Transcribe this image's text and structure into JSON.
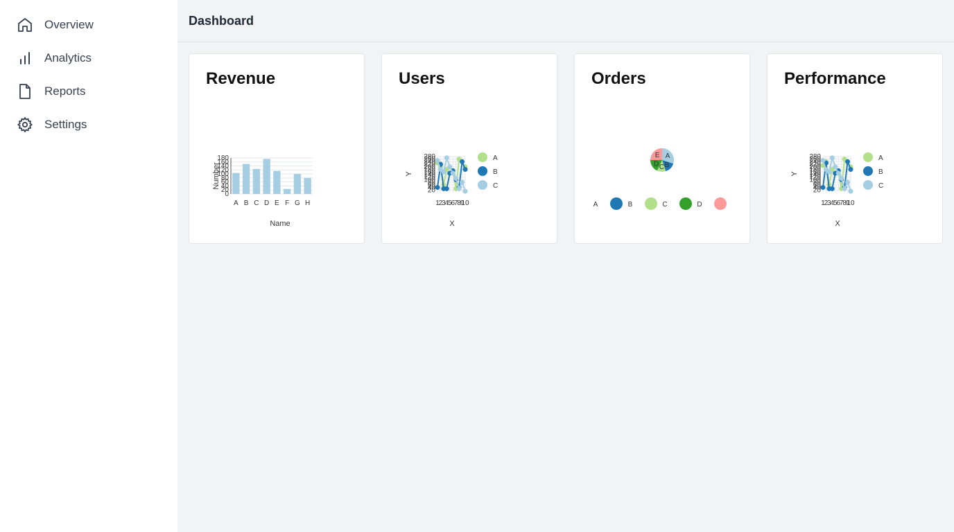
{
  "sidebar": {
    "items": [
      {
        "label": "Overview",
        "icon": "home-icon"
      },
      {
        "label": "Analytics",
        "icon": "bar-chart-icon"
      },
      {
        "label": "Reports",
        "icon": "file-icon"
      },
      {
        "label": "Settings",
        "icon": "gear-icon"
      }
    ]
  },
  "header": {
    "title": "Dashboard"
  },
  "cards": [
    {
      "title": "Revenue"
    },
    {
      "title": "Users"
    },
    {
      "title": "Orders"
    },
    {
      "title": "Performance"
    }
  ],
  "colors": {
    "light_blue": "#a6cee3",
    "dark_blue": "#1f78b4",
    "light_green": "#b2df8a",
    "green": "#33a02c",
    "pink": "#fb9a99",
    "sidebar_bg": "#ffffff",
    "page_bg": "#f2f3f5"
  },
  "chart_data": [
    {
      "type": "bar",
      "card": "Revenue",
      "categories": [
        "A",
        "B",
        "C",
        "D",
        "E",
        "F",
        "G",
        "H"
      ],
      "values": [
        105,
        150,
        125,
        175,
        115,
        25,
        100,
        80
      ],
      "xlabel": "Name",
      "ylabel": "Number",
      "ylim": [
        0,
        180
      ],
      "yticks": [
        0,
        20,
        40,
        60,
        80,
        100,
        120,
        140,
        160,
        180
      ],
      "grid": true
    },
    {
      "type": "line",
      "card": "Users",
      "x": [
        1,
        2,
        3,
        4,
        5,
        6,
        7,
        8,
        9,
        10
      ],
      "xticks": [
        "1",
        "2",
        "3",
        "4",
        "5",
        "6",
        "7",
        "8",
        "9",
        "10"
      ],
      "xlabel": "X",
      "ylabel": "Y",
      "ylim": [
        0,
        280
      ],
      "yticks": [
        20,
        40,
        60,
        80,
        100,
        120,
        140,
        160,
        180,
        200,
        220,
        240,
        260,
        280
      ],
      "legend_position": "right",
      "series": [
        {
          "name": "A",
          "color": "#b2df8a",
          "values": [
            230,
            200,
            60,
            180,
            150,
            170,
            30,
            260,
            240,
            200
          ]
        },
        {
          "name": "B",
          "color": "#1f78b4",
          "values": [
            40,
            220,
            30,
            30,
            150,
            170,
            100,
            40,
            240,
            180
          ]
        },
        {
          "name": "C",
          "color": "#a6cee3",
          "values": [
            250,
            180,
            160,
            270,
            200,
            150,
            110,
            30,
            80,
            10
          ]
        }
      ]
    },
    {
      "type": "pie",
      "card": "Orders",
      "labels": [
        "A",
        "B",
        "C",
        "D",
        "E"
      ],
      "values": [
        30,
        15,
        12,
        18,
        25
      ],
      "colors": [
        "#a6cee3",
        "#1f78b4",
        "#b2df8a",
        "#33a02c",
        "#fb9a99"
      ],
      "legend_position": "bottom"
    },
    {
      "type": "line",
      "card": "Performance",
      "x": [
        1,
        2,
        3,
        4,
        5,
        6,
        7,
        8,
        9,
        10
      ],
      "xticks": [
        "1",
        "2",
        "3",
        "4",
        "5",
        "6",
        "7",
        "8",
        "9",
        "10"
      ],
      "xlabel": "X",
      "ylabel": "Y",
      "ylim": [
        0,
        280
      ],
      "yticks": [
        20,
        40,
        60,
        80,
        100,
        120,
        140,
        160,
        180,
        200,
        220,
        240,
        260,
        280
      ],
      "legend_position": "right",
      "series": [
        {
          "name": "A",
          "color": "#b2df8a",
          "values": [
            210,
            240,
            60,
            180,
            150,
            170,
            30,
            260,
            240,
            200
          ]
        },
        {
          "name": "B",
          "color": "#1f78b4",
          "values": [
            40,
            230,
            30,
            30,
            150,
            170,
            100,
            40,
            240,
            180
          ]
        },
        {
          "name": "C",
          "color": "#a6cee3",
          "values": [
            250,
            180,
            160,
            270,
            200,
            150,
            110,
            30,
            80,
            10
          ]
        }
      ]
    }
  ]
}
